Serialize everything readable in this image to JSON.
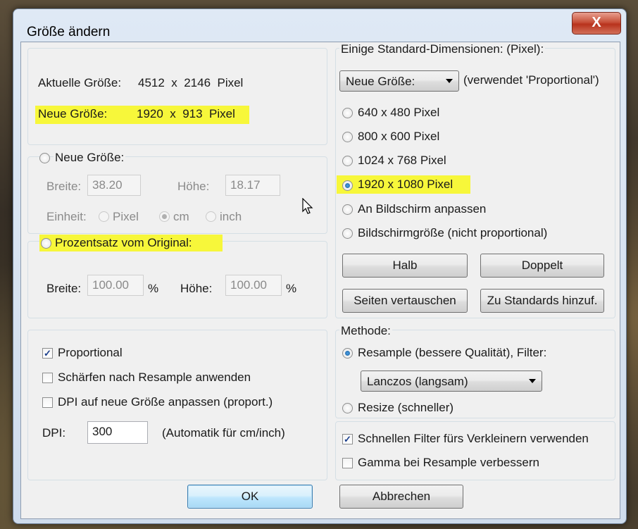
{
  "window": {
    "title": "Größe ändern",
    "close_label": "X"
  },
  "size_info": {
    "current_label": "Aktuelle Größe:",
    "current_value": "4512  x  2146  Pixel",
    "new_label": "Neue Größe:",
    "new_value": "1920  x  913  Pixel"
  },
  "new_size": {
    "radio_label": "Neue Größe:",
    "width_label": "Breite:",
    "width_value": "38.20",
    "height_label": "Höhe:",
    "height_value": "18.17",
    "unit_label": "Einheit:",
    "unit_options": [
      "Pixel",
      "cm",
      "inch"
    ],
    "unit_selected": "cm"
  },
  "percent": {
    "radio_label": "Prozentsatz vom Original:",
    "width_label": "Breite:",
    "width_value": "100.00",
    "height_label": "Höhe:",
    "height_value": "100.00",
    "unit": "%"
  },
  "options": {
    "proportional": "Proportional",
    "proportional_checked": true,
    "sharpen": "Schärfen nach Resample anwenden",
    "sharpen_checked": false,
    "dpi_adjust": "DPI auf neue Größe anpassen (proport.)",
    "dpi_adjust_checked": false,
    "dpi_label": "DPI:",
    "dpi_value": "300",
    "dpi_note": "(Automatik für cm/inch)"
  },
  "standard": {
    "group_label": "Einige Standard-Dimensionen: (Pixel):",
    "dropdown_value": "Neue Größe:",
    "dropdown_note": "(verwendet 'Proportional')",
    "presets": [
      "640 x 480 Pixel",
      "800 x 600 Pixel",
      "1024 x 768 Pixel",
      "1920 x 1080 Pixel",
      "An Bildschirm anpassen",
      "Bildschirmgröße (nicht proportional)"
    ],
    "selected_preset": "1920 x 1080 Pixel",
    "half_button": "Halb",
    "double_button": "Doppelt",
    "swap_button": "Seiten vertauschen",
    "add_button": "Zu Standards hinzuf."
  },
  "method": {
    "group_label": "Methode:",
    "resample_label": "Resample (bessere Qualität), Filter:",
    "filter_value": "Lanczos (langsam)",
    "resize_label": "Resize (schneller)",
    "selected": "resample",
    "fast_filter": "Schnellen Filter fürs Verkleinern verwenden",
    "fast_filter_checked": true,
    "gamma": "Gamma bei Resample verbessern",
    "gamma_checked": false
  },
  "footer": {
    "ok": "OK",
    "cancel": "Abbrechen"
  },
  "colors": {
    "highlight": "#f7f73a",
    "titlebar": "#dfe9f5",
    "close": "#c7503a"
  }
}
